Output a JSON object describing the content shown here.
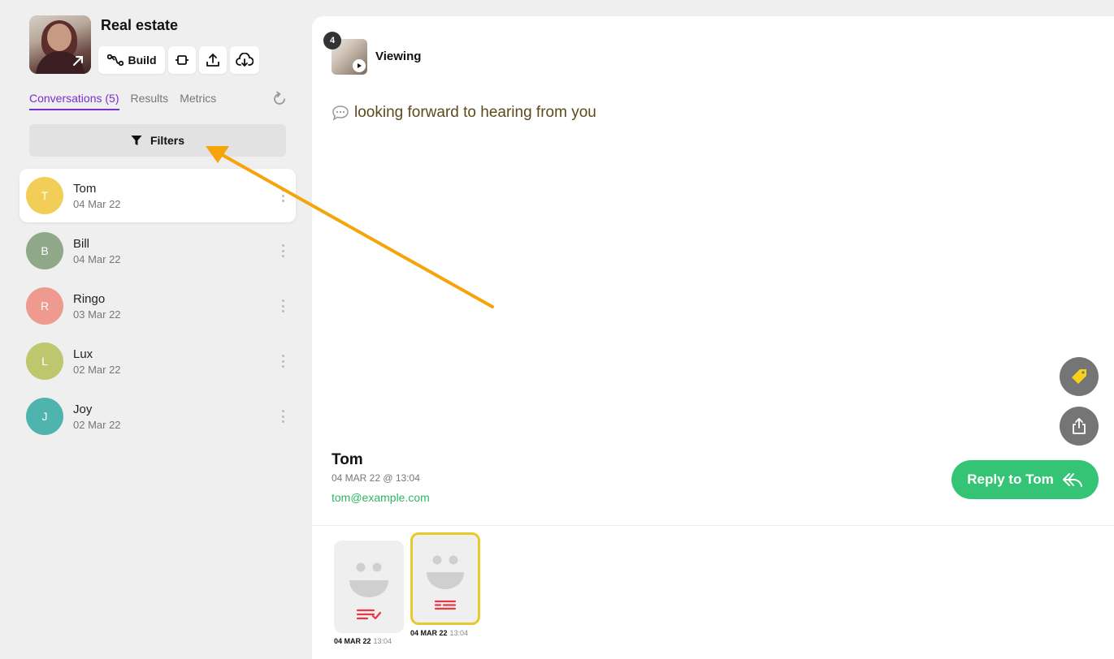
{
  "project": {
    "title": "Real estate",
    "build_label": "Build"
  },
  "tabs": [
    {
      "label": "Conversations (5)",
      "active": true
    },
    {
      "label": "Results",
      "active": false
    },
    {
      "label": "Metrics",
      "active": false
    }
  ],
  "filters_label": "Filters",
  "conversations": [
    {
      "initial": "T",
      "name": "Tom",
      "date": "04 Mar 22",
      "color": "#f2cd58",
      "selected": true
    },
    {
      "initial": "B",
      "name": "Bill",
      "date": "04 Mar 22",
      "color": "#8fa888",
      "selected": false
    },
    {
      "initial": "R",
      "name": "Ringo",
      "date": "03 Mar 22",
      "color": "#ef9a8e",
      "selected": false
    },
    {
      "initial": "L",
      "name": "Lux",
      "date": "02 Mar 22",
      "color": "#bec76d",
      "selected": false
    },
    {
      "initial": "J",
      "name": "Joy",
      "date": "02 Mar 22",
      "color": "#4fb4ae",
      "selected": false
    }
  ],
  "viewer": {
    "badge": "4",
    "label": "Viewing",
    "message": "looking forward to hearing from you"
  },
  "contact": {
    "name": "Tom",
    "datetime": "04 MAR 22 @ 13:04",
    "email": "tom@example.com",
    "reply_label": "Reply to Tom"
  },
  "responses": [
    {
      "date": "04 MAR 22",
      "time": "13:04",
      "selected": false
    },
    {
      "date": "04 MAR 22",
      "time": "13:04",
      "selected": true
    }
  ],
  "colors": {
    "accent": "#7a2dd0",
    "reply": "#35c476",
    "annotation_arrow": "#f5a50b",
    "selected_card": "#e8c92d"
  }
}
